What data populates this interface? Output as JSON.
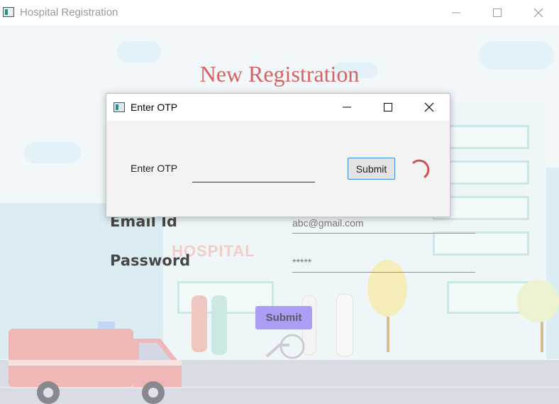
{
  "window": {
    "title": "Hospital Registration",
    "controls": {
      "minimize": "—",
      "maximize": "☐",
      "close": "✕"
    }
  },
  "page": {
    "heading": "New Registration",
    "hospital_sign": "HOSPITAL",
    "fields": [
      {
        "label": "Email Id",
        "value": "abc@gmail.com"
      },
      {
        "label": "Password",
        "value": "*****"
      }
    ],
    "submit_label": "Submit"
  },
  "dialog": {
    "title": "Enter OTP",
    "otp_label": "Enter OTP",
    "otp_value": "",
    "submit_label": "Submit",
    "loading": true
  },
  "colors": {
    "heading": "#c62828",
    "submit_button": "#8c78f0",
    "spinner": "#cc3333",
    "dialog_border": "#d4b6df",
    "focus_border": "#3a8dd6"
  },
  "icons": [
    "app-icon",
    "minimize-icon",
    "maximize-icon",
    "close-icon",
    "loading-spinner-icon"
  ]
}
